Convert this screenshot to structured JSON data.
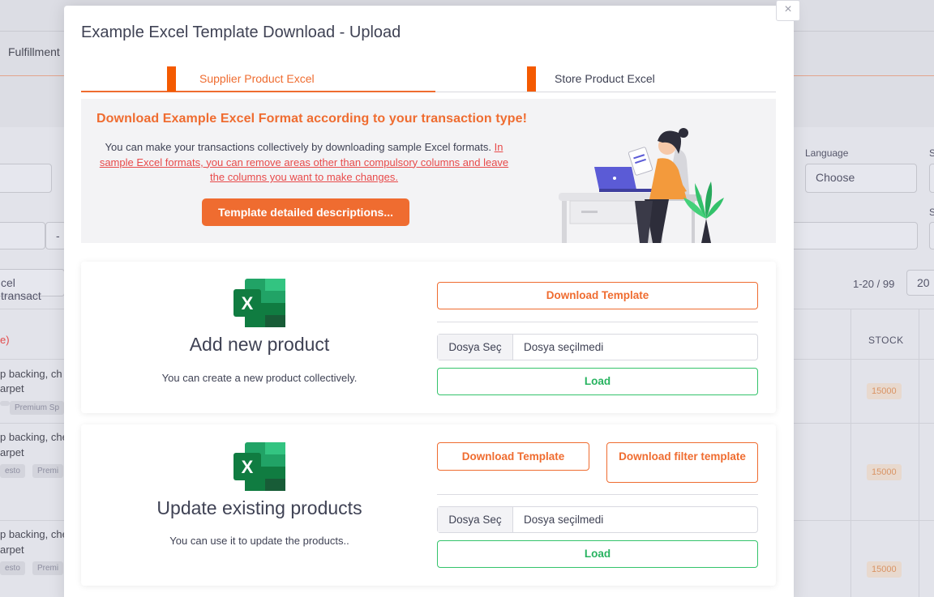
{
  "background": {
    "nav_item": "Fulfillment",
    "language_label": "Language",
    "language_value": "Choose",
    "side_label_1": "S",
    "side_label_2": "S",
    "dash": "-",
    "search_fragment": "cel transact",
    "pagination": "1-20 / 99",
    "per_page": "20",
    "link_fragment": "e)",
    "stock_header": "STOCK",
    "rows": [
      {
        "line1": "p backing, ch",
        "line2": "arpet",
        "chip1": "",
        "chip2": "Premium Sp",
        "stock": "15000"
      },
      {
        "line1": "p backing, che",
        "line2": "arpet",
        "chip1": "esto",
        "chip2": "Premi",
        "stock": "15000"
      },
      {
        "line1": "p backing, che",
        "line2": "arpet",
        "chip1": "esto",
        "chip2": "Premi",
        "stock": "15000"
      }
    ]
  },
  "modal": {
    "title": "Example Excel Template Download - Upload",
    "close_label": "×",
    "tabs": [
      {
        "label": "Supplier Product Excel",
        "active": true
      },
      {
        "label": "Store Product Excel",
        "active": false
      }
    ],
    "promo": {
      "headline": "Download Example Excel Format according to your transaction type!",
      "desc_plain": "You can make your transactions collectively by downloading sample Excel formats.",
      "desc_link": "In sample Excel formats, you can remove areas other than compulsory columns and leave the columns you want to make changes.",
      "button": "Template detailed descriptions..."
    },
    "cards": [
      {
        "title": "Add new product",
        "subtitle": "You can create a new product collectively.",
        "download_label": "Download Template",
        "file_button": "Dosya Seç",
        "file_status": "Dosya seçilmedi",
        "load_label": "Load"
      },
      {
        "title": "Update existing products",
        "subtitle": "You can use it to update the products..",
        "download_label": "Download Template",
        "download_filter_label": "Download filter template",
        "file_button": "Dosya Seç",
        "file_status": "Dosya seçilmedi",
        "load_label": "Load"
      }
    ]
  },
  "colors": {
    "accent": "#ef6c30",
    "tab_marker": "#f45a00",
    "link": "#e84a4a",
    "load_green": "#28b360"
  }
}
